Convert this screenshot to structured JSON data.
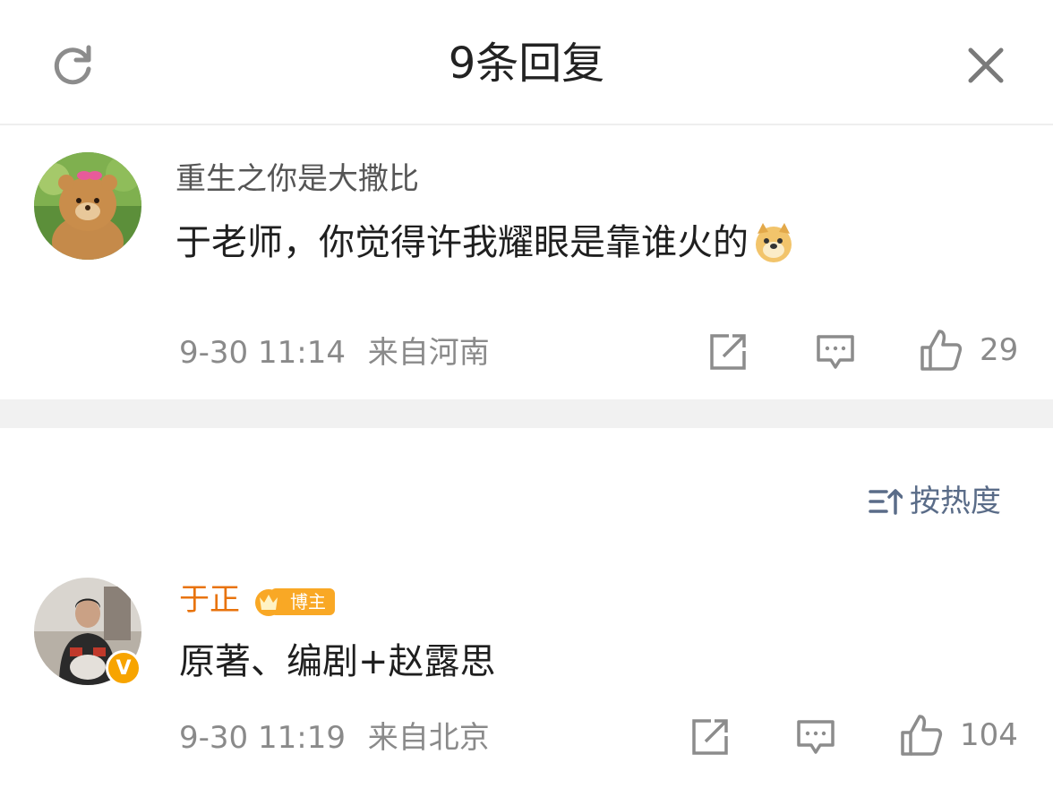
{
  "header": {
    "title": "9条回复",
    "refresh_icon": "refresh-icon",
    "close_icon": "close-icon"
  },
  "root_comment": {
    "username": "重生之你是大撒比",
    "text": "于老师，你觉得许我耀眼是靠谁火的",
    "emoji": "doge-emoji",
    "time": "9-30 11:14",
    "location": "来自河南",
    "like_count": "29"
  },
  "sort": {
    "label": "按热度",
    "icon": "sort-icon"
  },
  "replies": [
    {
      "username": "于正",
      "badge": "博主",
      "text": "原著、编剧+赵露思",
      "time": "9-30 11:19",
      "location": "来自北京",
      "like_count": "104"
    }
  ],
  "colors": {
    "text_primary": "#1f1f1f",
    "text_secondary": "#8a8a8a",
    "author_name": "#e8730c",
    "sort_blue": "#5a6c88",
    "badge_orange": "#f9a825"
  }
}
